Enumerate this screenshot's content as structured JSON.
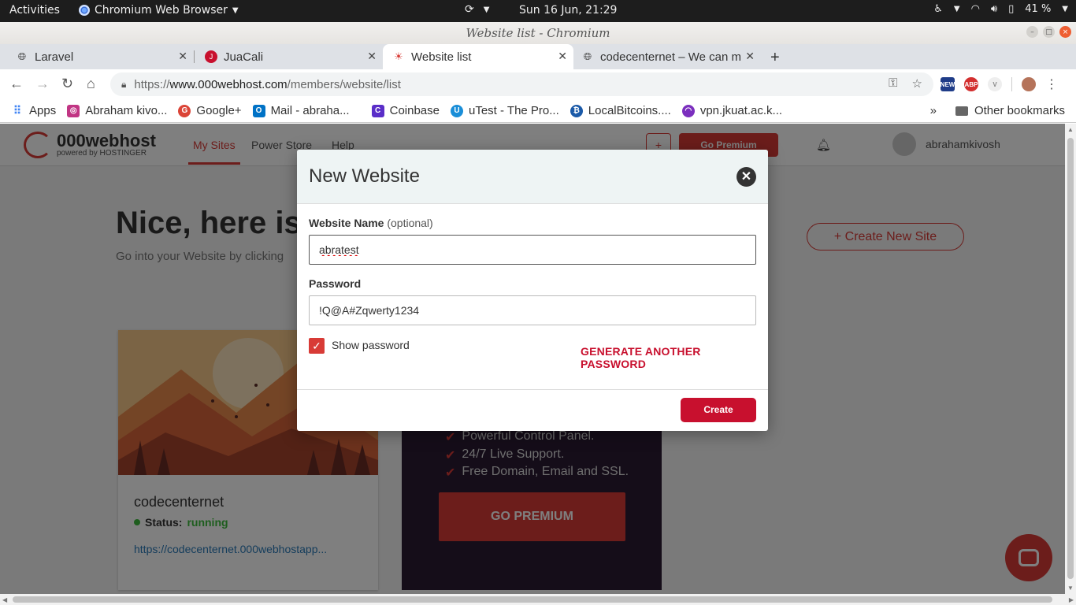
{
  "system_bar": {
    "activities": "Activities",
    "app_name": "Chromium Web Browser",
    "clock": "Sun 16 Jun, 21:29",
    "battery": "41 %"
  },
  "window": {
    "title": "Website list - Chromium"
  },
  "tabs": [
    {
      "label": "Laravel",
      "icon": "globe-icon"
    },
    {
      "label": "JuaCali",
      "icon": "juacali-icon"
    },
    {
      "label": "Website list",
      "icon": "000webhost-icon",
      "active": true
    },
    {
      "label": "codecenternet – We can m",
      "icon": "globe-icon"
    }
  ],
  "address_bar": {
    "scheme": "https://",
    "host": "www.000webhost.com",
    "path": "/members/website/list"
  },
  "bookmarks": {
    "items": [
      {
        "label": "Apps",
        "icon": "apps-grid-icon"
      },
      {
        "label": "Abraham kivo...",
        "icon": "instagram-icon"
      },
      {
        "label": "Google+",
        "icon": "google-plus-icon"
      },
      {
        "label": "Mail - abraha...",
        "icon": "outlook-icon"
      },
      {
        "label": "Coinbase",
        "icon": "coinbase-icon"
      },
      {
        "label": "uTest - The Pro...",
        "icon": "utest-icon"
      },
      {
        "label": "LocalBitcoins....",
        "icon": "localbitcoins-icon"
      },
      {
        "label": "vpn.jkuat.ac.k...",
        "icon": "wifi-icon"
      }
    ],
    "overflow": "»",
    "other": "Other bookmarks"
  },
  "site": {
    "logo_main": "000webhost",
    "logo_sub": "powered by HOSTINGER",
    "nav": [
      "My Sites",
      "Power Store",
      "Help"
    ],
    "header_plus": "+",
    "header_premium": "Go Premium",
    "username": "abrahamkivosh",
    "hero_title": "Nice, here is",
    "hero_subtitle": "Go into your Website by clicking",
    "create_new_site": "+ Create New Site",
    "site_card": {
      "name": "codecenternet",
      "status_label": "Status:",
      "status_value": "running",
      "url": "https://codecenternet.000webhostapp..."
    },
    "premium_card": {
      "features": [
        "Powerful Control Panel.",
        "24/7 Live Support.",
        "Free Domain, Email and SSL."
      ],
      "button": "GO PREMIUM"
    }
  },
  "modal": {
    "title": "New Website",
    "name_label": "Website Name",
    "name_optional": "(optional)",
    "name_value": "abratest",
    "password_label": "Password",
    "password_value": "!Q@A#Zqwerty1234",
    "show_password": "Show password",
    "show_password_checked": true,
    "generate": "GENERATE ANOTHER PASSWORD",
    "create": "Create"
  },
  "colors": {
    "brand": "#d83b36",
    "create": "#c8102e",
    "running": "#3cbb3c"
  }
}
